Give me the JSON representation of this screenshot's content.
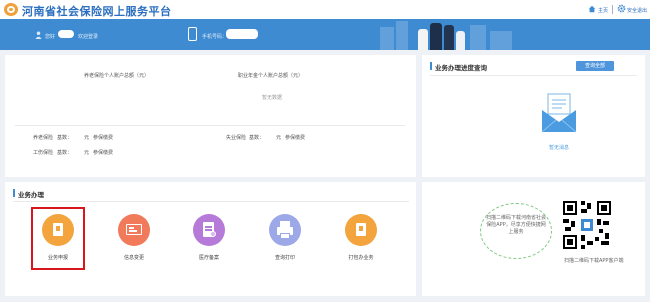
{
  "header": {
    "site_title": "河南省社会保险网上服务平台",
    "home_label": "主页",
    "logout_label": "安全退出"
  },
  "banner": {
    "welcome_prefix": "您好",
    "login_status": "欢迎登录",
    "phone_label": "手机号码："
  },
  "account_panel": {
    "pension_total_label": "养老保险个人账户总额（元）",
    "annuity_total_label": "职业年金个人账户总额（元）",
    "no_data": "暂无数据",
    "rows": [
      {
        "label": "养老保险",
        "base_label": "基数：",
        "unit": "元",
        "status": "参保缴费"
      },
      {
        "label": "失业保险",
        "base_label": "基数：",
        "unit": "元",
        "status": "参保缴费"
      },
      {
        "label": "工伤保险",
        "base_label": "基数：",
        "unit": "元",
        "status": "参保缴费"
      }
    ]
  },
  "progress_panel": {
    "title": "业务办理进度查询",
    "query_all": "查询全部",
    "empty_text": "暂无消息"
  },
  "business_panel": {
    "title": "业务办理",
    "services": [
      {
        "label": "业务申报",
        "color": "#f3a43d",
        "icon": "folder-icon"
      },
      {
        "label": "信息变更",
        "color": "#f07a5a",
        "icon": "id-card-icon"
      },
      {
        "label": "医疗备案",
        "color": "#b67ad8",
        "icon": "document-icon"
      },
      {
        "label": "查询打印",
        "color": "#9ca8e8",
        "icon": "printer-icon"
      },
      {
        "label": "打包办业务",
        "color": "#f3a43d",
        "icon": "folder-icon"
      }
    ]
  },
  "app_panel": {
    "download_hint": "扫描二维码下载河南省社会保险APP，尽享方便快捷网上服务",
    "qr_caption": "扫描二维码下载APP客户端"
  },
  "colors": {
    "brand_blue": "#3f8bd2",
    "highlight_red": "#d9161c"
  }
}
